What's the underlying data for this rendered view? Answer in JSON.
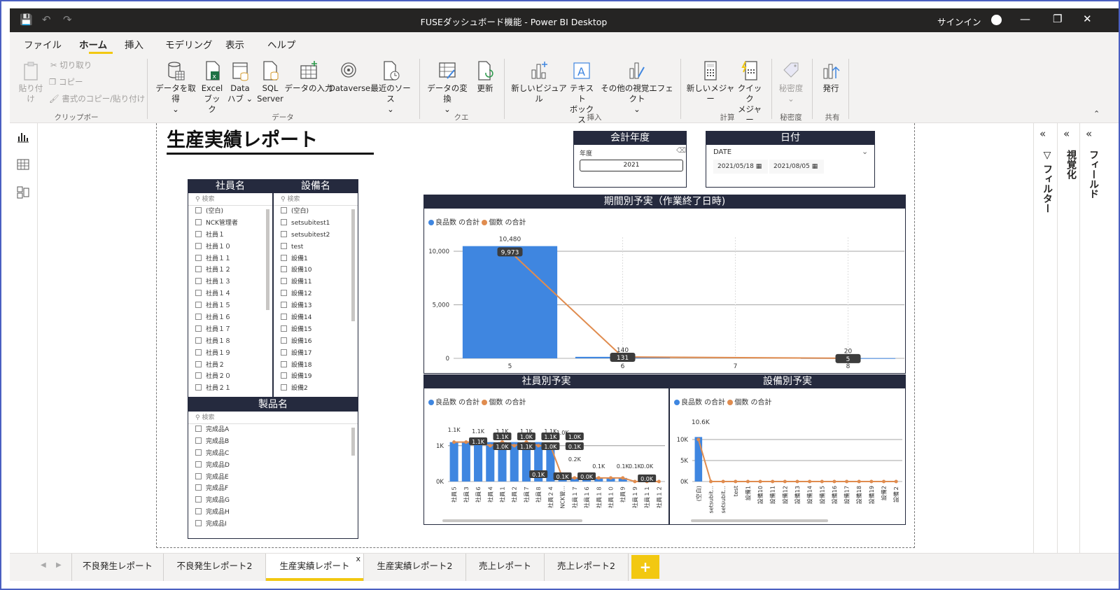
{
  "window": {
    "title": "FUSEダッシュボード機能 - Power BI Desktop",
    "signin": "サインイン"
  },
  "menu": [
    "ファイル",
    "ホーム",
    "挿入",
    "モデリング",
    "表示",
    "ヘルプ"
  ],
  "ribbon": {
    "clipboard": {
      "paste": "貼り付け",
      "cut": "切り取り",
      "copy": "コピー",
      "format_painter": "書式のコピー/貼り付け",
      "group": "クリップボード"
    },
    "data": {
      "get_data": "データを取得",
      "excel1": "Excel",
      "excel2": "ブック",
      "datahub1": "Data",
      "datahub2": "ハブ",
      "sql1": "SQL",
      "sql2": "Server",
      "enter_data": "データの入力",
      "dataverse": "Dataverse",
      "recent": "最近のソース",
      "group": "データ"
    },
    "query": {
      "transform": "データの変換",
      "refresh": "更新",
      "group": "クエリ"
    },
    "insert": {
      "new_visual": "新しいビジュアル",
      "textbox1": "テキスト",
      "textbox2": "ボックス",
      "more_visuals": "その他の視覚エフェクト",
      "group": "挿入"
    },
    "calc": {
      "new_measure": "新しいメジャー",
      "quick1": "クイック",
      "quick2": "メジャー",
      "group": "計算"
    },
    "sensitivity": {
      "label": "秘密度",
      "group": "秘密度"
    },
    "share": {
      "publish": "発行",
      "group": "共有"
    }
  },
  "report": {
    "title": "生産実績レポート",
    "slicers": {
      "employee": {
        "title": "社員名",
        "search": "検索",
        "items": [
          "(空白)",
          "NCK管理者",
          "社員１",
          "社員１０",
          "社員１１",
          "社員１２",
          "社員１３",
          "社員１４",
          "社員１５",
          "社員１６",
          "社員１７",
          "社員１８",
          "社員１９",
          "社員２",
          "社員２０",
          "社員２１"
        ]
      },
      "equipment": {
        "title": "設備名",
        "search": "検索",
        "items": [
          "(空白)",
          "setsubitest1",
          "setsubitest2",
          "test",
          "設備1",
          "設備10",
          "設備11",
          "設備12",
          "設備13",
          "設備14",
          "設備15",
          "設備16",
          "設備17",
          "設備18",
          "設備19",
          "設備2"
        ]
      },
      "product": {
        "title": "製品名",
        "search": "検索",
        "items": [
          "完成品A",
          "完成品B",
          "完成品C",
          "完成品D",
          "完成品E",
          "完成品F",
          "完成品G",
          "完成品H",
          "完成品I"
        ]
      },
      "fiscal": {
        "title": "会計年度",
        "label": "年度",
        "value": "2021"
      },
      "date": {
        "title": "日付",
        "label": "DATE",
        "from": "2021/05/18",
        "to": "2021/08/05"
      }
    }
  },
  "chart_data": [
    {
      "type": "bar",
      "title": "期間別予実（作業終了日時)",
      "legend": [
        "良品数 の合計",
        "個数 の合計"
      ],
      "categories": [
        "5",
        "6",
        "7",
        "8"
      ],
      "series": [
        {
          "name": "良品数 の合計",
          "kind": "bar",
          "values": [
            10480,
            140,
            null,
            20
          ]
        },
        {
          "name": "個数 の合計",
          "kind": "line",
          "values": [
            9973,
            131,
            null,
            5
          ]
        }
      ],
      "bar_labels": [
        "10,480",
        "140",
        "",
        "20"
      ],
      "line_labels": [
        "9,973",
        "131",
        "",
        "5"
      ],
      "yticks": [
        "10,000",
        "5,000",
        "0"
      ],
      "ylim": [
        0,
        10000
      ]
    },
    {
      "type": "bar",
      "title": "社員別予実",
      "legend": [
        "良品数 の合計",
        "個数 の合計"
      ],
      "categories": [
        "社員５",
        "社員３",
        "社員６",
        "社員４",
        "社員１",
        "社員２",
        "社員７",
        "社員８",
        "社員２４",
        "NCK管...",
        "社員１７",
        "社員１６",
        "社員１８",
        "社員１０",
        "社員９",
        "社員１９",
        "社員１１",
        "社員１２"
      ],
      "series": [
        {
          "name": "良品数 の合計",
          "kind": "bar",
          "values": [
            1100,
            1100,
            1100,
            1100,
            1100,
            1100,
            1100,
            1100,
            1000,
            200,
            100,
            100,
            100,
            100,
            100,
            0,
            0,
            0
          ]
        },
        {
          "name": "個数 の合計",
          "kind": "line",
          "values": [
            1100,
            1100,
            1100,
            1000,
            1100,
            1000,
            1100,
            1000,
            1000,
            100,
            100,
            100,
            100,
            100,
            100,
            0,
            0,
            0
          ]
        }
      ],
      "bar_labels": [
        "1.1K",
        "1.1K",
        "1.1K",
        "1.1K",
        "1.1K",
        "1.0K",
        "0.2K",
        "0.1K",
        "0.1K",
        "0.1K",
        "0.0K"
      ],
      "line_labels": [
        "1.1K",
        "1.1K",
        "1.0K",
        "1.1K",
        "1.0K",
        "1.0K",
        "1.1K",
        "1.0K",
        "0.1K",
        "0.1K",
        "0.1K",
        "0.0K",
        "0.0K"
      ],
      "yticks": [
        "1K",
        "0K"
      ],
      "ylim": [
        0,
        1250
      ]
    },
    {
      "type": "bar",
      "title": "設備別予実",
      "legend": [
        "良品数 の合計",
        "個数 の合計"
      ],
      "categories": [
        "(空白)",
        "setsubit...",
        "setsubit...",
        "test",
        "設備1",
        "設備10",
        "設備11",
        "設備12",
        "設備13",
        "設備14",
        "設備15",
        "設備16",
        "設備17",
        "設備18",
        "設備19",
        "設備2",
        "設備２"
      ],
      "series": [
        {
          "name": "良品数 の合計",
          "kind": "bar",
          "values": [
            10600,
            0,
            0,
            0,
            0,
            0,
            0,
            0,
            0,
            0,
            0,
            0,
            0,
            0,
            0,
            0,
            0
          ]
        },
        {
          "name": "個数 の合計",
          "kind": "line",
          "values": [
            10000,
            0,
            0,
            0,
            0,
            0,
            0,
            0,
            0,
            0,
            0,
            0,
            0,
            0,
            0,
            0,
            0
          ]
        }
      ],
      "bar_labels": [
        "10.6K"
      ],
      "yticks": [
        "10K",
        "5K",
        "0K"
      ],
      "ylim": [
        0,
        12000
      ]
    }
  ],
  "panes": {
    "filter": "フィルター",
    "visualize": "視覚化",
    "fields": "フィールド"
  },
  "tabs": [
    "不良発生レポート",
    "不良発生レポート2",
    "生産実績レポート",
    "生産実績レポート2",
    "売上レポート",
    "売上レポート2"
  ],
  "add_tab": "+",
  "colors": {
    "bar": "#3f86e0",
    "line": "#e08c4f",
    "header": "#252a3e",
    "accent": "#f2c811"
  }
}
